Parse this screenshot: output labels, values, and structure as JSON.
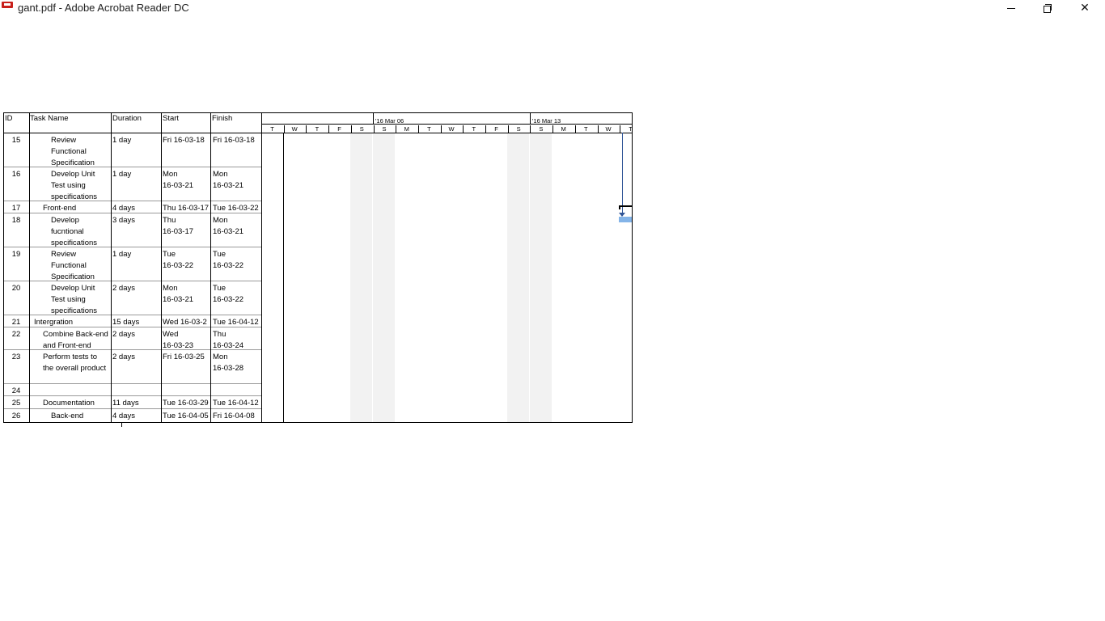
{
  "window": {
    "title": "gant.pdf - Adobe Acrobat Reader DC",
    "minimize_glyph": "",
    "close_glyph": "✕"
  },
  "table": {
    "headers": {
      "id": "ID",
      "name": "Task Name",
      "duration": "Duration",
      "start": "Start",
      "finish": "Finish"
    },
    "rows": [
      {
        "id": "15",
        "name": "Review\nFunctional\nSpecification",
        "indent": 3,
        "duration": "1 day",
        "start": "Fri 16-03-18",
        "finish": "Fri 16-03-18"
      },
      {
        "id": "16",
        "name": "Develop Unit\nTest using\nspecifications",
        "indent": 3,
        "duration": "1 day",
        "start": "Mon\n16-03-21",
        "finish": "Mon\n16-03-21"
      },
      {
        "id": "17",
        "name": "Front-end",
        "indent": 2,
        "duration": "4 days",
        "start": "Thu 16-03-17",
        "finish": "Tue 16-03-22"
      },
      {
        "id": "18",
        "name": "Develop\nfucntional\nspecifications",
        "indent": 3,
        "duration": "3 days",
        "start": "Thu\n16-03-17",
        "finish": "Mon\n16-03-21"
      },
      {
        "id": "19",
        "name": "Review\nFunctional\nSpecification",
        "indent": 3,
        "duration": "1 day",
        "start": "Tue\n16-03-22",
        "finish": "Tue\n16-03-22"
      },
      {
        "id": "20",
        "name": "Develop Unit\nTest using\nspecifications",
        "indent": 3,
        "duration": "2 days",
        "start": "Mon\n16-03-21",
        "finish": "Tue\n16-03-22"
      },
      {
        "id": "21",
        "name": "Intergration",
        "indent": 1,
        "duration": "15 days",
        "start": "Wed 16-03-2",
        "finish": "Tue 16-04-12"
      },
      {
        "id": "22",
        "name": "Combine Back-end\nand Front-end",
        "indent": 2,
        "duration": "2 days",
        "start": "Wed\n16-03-23",
        "finish": "Thu\n16-03-24"
      },
      {
        "id": "23",
        "name": "Perform tests to\nthe overall product",
        "indent": 2,
        "duration": "2 days",
        "start": "Fri 16-03-25",
        "finish": "Mon\n16-03-28"
      },
      {
        "id": "24",
        "name": "",
        "indent": 1,
        "duration": "",
        "start": "",
        "finish": ""
      },
      {
        "id": "25",
        "name": "Documentation",
        "indent": 2,
        "duration": "11 days",
        "start": "Tue 16-03-29",
        "finish": "Tue 16-04-12"
      },
      {
        "id": "26",
        "name": "Back-end",
        "indent": 3,
        "duration": "4 days",
        "start": "Tue 16-04-05",
        "finish": "Fri 16-04-08"
      }
    ]
  },
  "timescale": {
    "weeks": [
      "'16 Mar 06",
      "'16 Mar 13"
    ],
    "days": [
      "T",
      "W",
      "T",
      "F",
      "S",
      "S",
      "M",
      "T",
      "W",
      "T",
      "F",
      "S",
      "S",
      "M",
      "T",
      "W",
      "T"
    ]
  },
  "colors": {
    "task_bar": "#84b4e8",
    "dependency_line": "#2f5496",
    "weekend_shade": "#f2f2f2",
    "app_icon": "#c8201b"
  }
}
